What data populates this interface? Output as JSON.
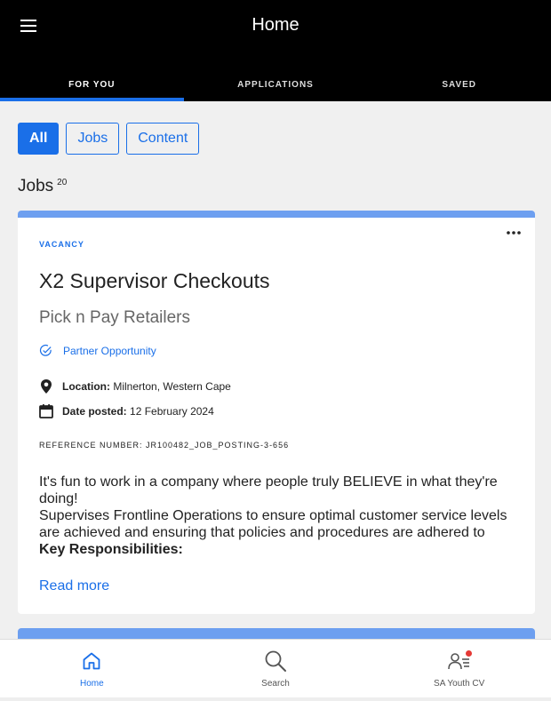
{
  "header": {
    "title": "Home",
    "tabs": [
      {
        "label": "FOR YOU",
        "active": true
      },
      {
        "label": "APPLICATIONS",
        "active": false
      },
      {
        "label": "SAVED",
        "active": false
      }
    ]
  },
  "filters": [
    {
      "label": "All",
      "active": true
    },
    {
      "label": "Jobs",
      "active": false
    },
    {
      "label": "Content",
      "active": false
    }
  ],
  "section": {
    "title": "Jobs",
    "count": "20"
  },
  "job": {
    "kicker": "VACANCY",
    "title": "X2 Supervisor Checkouts",
    "company": "Pick n Pay Retailers",
    "partner_label": "Partner Opportunity",
    "location_label": "Location:",
    "location_value": "Milnerton, Western Cape",
    "date_label": "Date posted:",
    "date_value": "12 February 2024",
    "reference": "REFERENCE NUMBER: JR100482_JOB_POSTING-3-656",
    "description": [
      "It's fun to work in a company where people truly BELIEVE in what they're doing!",
      "Supervises Frontline Operations to ensure optimal customer service levels are achieved and ensuring that policies and procedures are adhered to",
      "Key Responsibilities:"
    ],
    "read_more": "Read more"
  },
  "bottom_nav": [
    {
      "label": "Home",
      "icon": "home-icon",
      "active": true
    },
    {
      "label": "Search",
      "icon": "search-icon",
      "active": false
    },
    {
      "label": "SA Youth CV",
      "icon": "cv-icon",
      "active": false
    }
  ],
  "colors": {
    "accent": "#1a6fe8",
    "card_top": "#6d9ff0",
    "header_bg": "#000000",
    "notification": "#e53935"
  }
}
